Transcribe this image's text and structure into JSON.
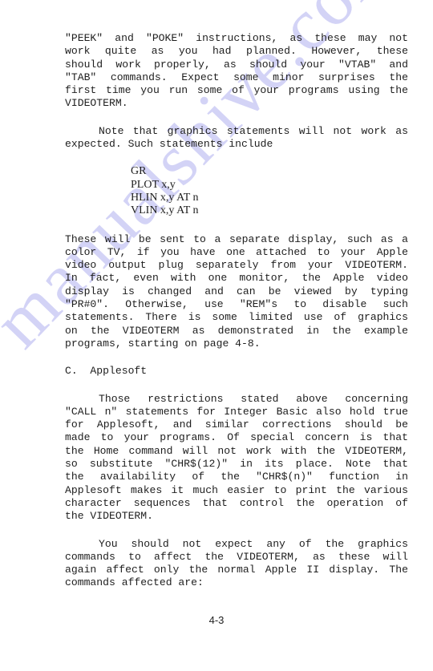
{
  "watermark": "manualshive.com",
  "paragraphs": {
    "p1": [
      "\"PEEK\" and \"POKE\" instructions, as these may not",
      "work quite as you had planned. However, these",
      "should work properly, as should your \"VTAB\" and",
      "\"TAB\" commands. Expect some minor surprises the",
      "first time you run some of your programs using the",
      "VIDEOTERM."
    ],
    "p2": [
      "Note that graphics statements will not work as",
      "expected. Such statements include"
    ],
    "code": [
      "GR",
      "PLOT x,y",
      "HLIN x,y AT n",
      "VLIN x,y AT n"
    ],
    "p3": [
      "These will be sent to a separate display, such as a",
      "color TV, if you have one attached to your Apple",
      "video output plug separately from your VIDEOTERM.",
      "In fact, even with one monitor, the Apple video",
      "display is changed and can be viewed by typing",
      "\"PR#0\". Otherwise, use \"REM\"s to disable such",
      "statements. There is some limited use of graphics",
      "on the VIDEOTERM as demonstrated in the example",
      "programs, starting on page 4-8."
    ],
    "heading": "C.  Applesoft",
    "p4": [
      "Those restrictions stated above concerning",
      "\"CALL n\" statements for Integer Basic also hold true",
      "for Applesoft, and similar corrections should be",
      "made to your programs. Of special concern is that",
      "the Home command will not work with the VIDEOTERM,",
      "so substitute \"CHR$(12)\" in its place. Note that",
      "the availability of the \"CHR$(n)\" function in",
      "Applesoft makes it much easier to print the various",
      "character sequences that control the operation of",
      "the VIDEOTERM."
    ],
    "p5": [
      "You should not expect any of the graphics",
      "commands to affect the VIDEOTERM, as these will",
      "again affect only the normal Apple II display. The",
      "commands affected are:"
    ]
  },
  "page_number": "4-3"
}
